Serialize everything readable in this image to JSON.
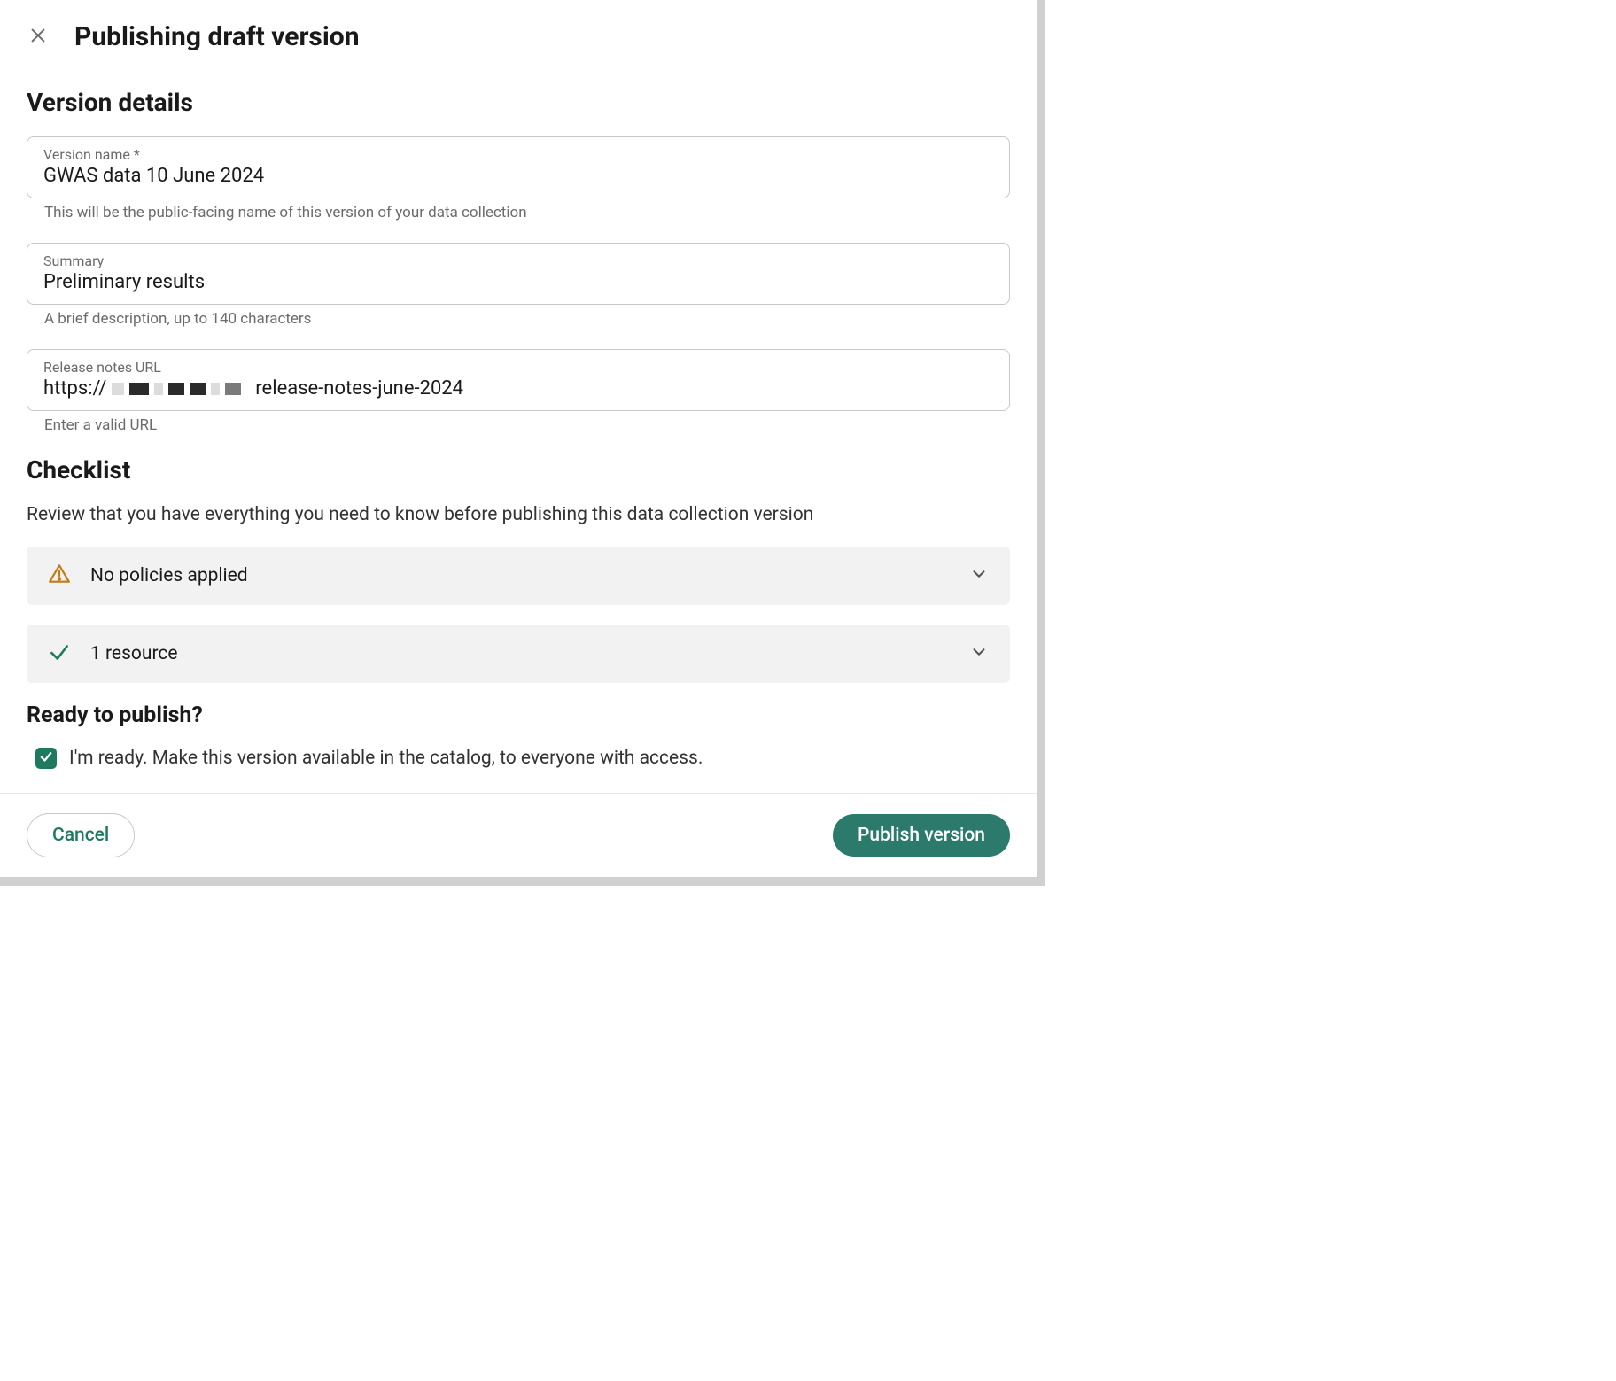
{
  "header": {
    "title": "Publishing draft version"
  },
  "details": {
    "heading": "Version details",
    "version_name": {
      "label": "Version name *",
      "value": "GWAS data 10 June 2024",
      "helper": "This will be the public-facing name of this version of your data collection"
    },
    "summary": {
      "label": "Summary",
      "value": "Preliminary results",
      "helper": "A brief description, up to 140 characters"
    },
    "release_notes": {
      "label": "Release notes URL",
      "prefix": "https://",
      "suffix": "release-notes-june-2024",
      "helper": "Enter a valid URL"
    }
  },
  "checklist": {
    "heading": "Checklist",
    "description": "Review that you have everything you need to know before publishing this data collection version",
    "items": [
      {
        "status": "warning",
        "label": "No policies applied"
      },
      {
        "status": "ok",
        "label": "1 resource"
      }
    ]
  },
  "ready": {
    "heading": "Ready to publish?",
    "checkbox_label": "I'm ready. Make this version available in the catalog, to everyone with access.",
    "checked": true
  },
  "footer": {
    "cancel_label": "Cancel",
    "publish_label": "Publish version"
  },
  "colors": {
    "primary": "#2c7a6b",
    "warning": "#c47a12",
    "ok": "#1e7a5f"
  }
}
